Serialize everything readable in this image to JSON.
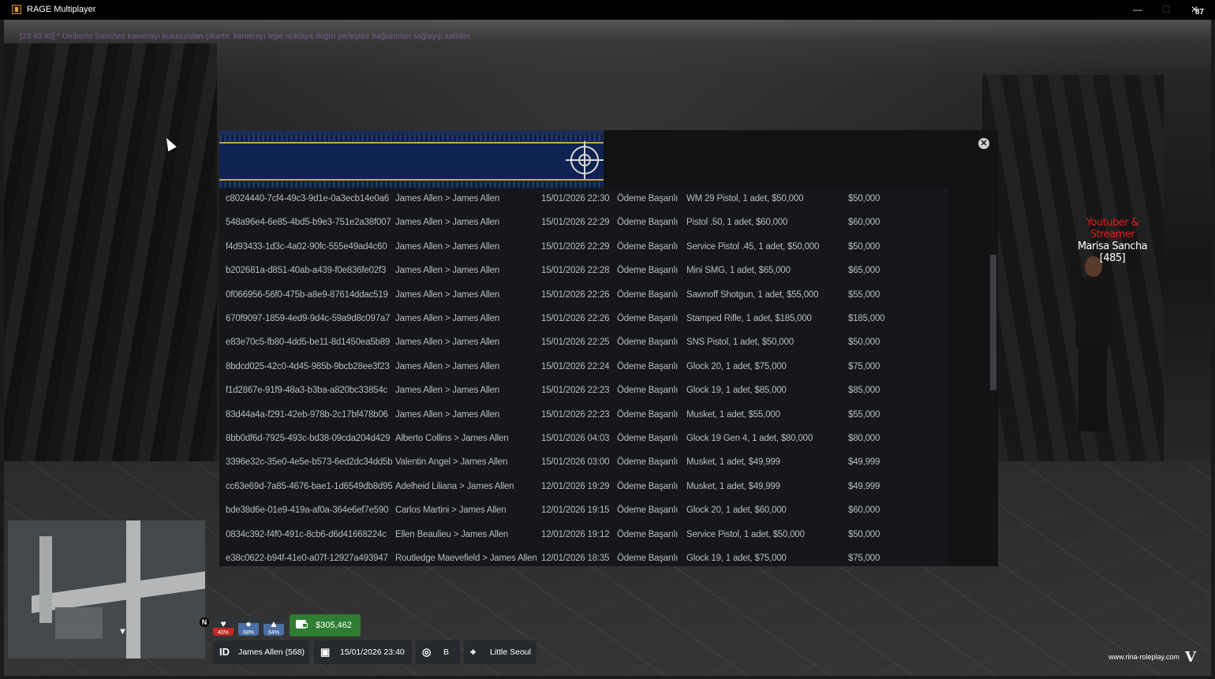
{
  "window": {
    "title": "RAGE Multiplayer",
    "fps": "87",
    "minimize": "—",
    "maximize": "☐",
    "close": "✕"
  },
  "chat": {
    "line": "[23:40:40] * Umberto Sanchez kamerayı kutusundan çıkartır, kamerayı tepe noktaya doğru yerleştirir bağlantıları sağlayıp sabitler."
  },
  "npc": {
    "role": "Youtuber & Streamer",
    "name": "Marisa Sancha [485]"
  },
  "modal": {
    "close_icon": "close-icon",
    "rows": [
      {
        "id": "c8024440-7cf4-49c3-9d1e-0a3ecb14e0a6",
        "from": "James Allen > James Allen",
        "date": "15/01/2026 22:30",
        "status": "Ödeme Başarılı",
        "item": "WM 29 Pistol, 1 adet, $50,000",
        "amount": "$50,000"
      },
      {
        "id": "548a96e4-6e85-4bd5-b9e3-751e2a38f007",
        "from": "James Allen > James Allen",
        "date": "15/01/2026 22:29",
        "status": "Ödeme Başarılı",
        "item": "Pistol .50, 1 adet, $60,000",
        "amount": "$60,000"
      },
      {
        "id": "f4d93433-1d3c-4a02-90fc-555e49ad4c60",
        "from": "James Allen > James Allen",
        "date": "15/01/2026 22:29",
        "status": "Ödeme Başarılı",
        "item": "Service Pistol .45, 1 adet, $50,000",
        "amount": "$50,000"
      },
      {
        "id": "b202681a-d851-40ab-a439-f0e836fe02f3",
        "from": "James Allen > James Allen",
        "date": "15/01/2026 22:28",
        "status": "Ödeme Başarılı",
        "item": "Mini SMG, 1 adet, $65,000",
        "amount": "$65,000"
      },
      {
        "id": "0f066956-56f0-475b-a8e9-87614ddac519",
        "from": "James Allen > James Allen",
        "date": "15/01/2026 22:26",
        "status": "Ödeme Başarılı",
        "item": "Sawnoff Shotgun, 1 adet, $55,000",
        "amount": "$55,000"
      },
      {
        "id": "670f9097-1859-4ed9-9d4c-59a9d8c097a7",
        "from": "James Allen > James Allen",
        "date": "15/01/2026 22:26",
        "status": "Ödeme Başarılı",
        "item": "Stamped Rifle, 1 adet, $185,000",
        "amount": "$185,000"
      },
      {
        "id": "e83e70c5-fb80-4dd5-be11-8d1450ea5b89",
        "from": "James Allen > James Allen",
        "date": "15/01/2026 22:25",
        "status": "Ödeme Başarılı",
        "item": "SNS Pistol, 1 adet, $50,000",
        "amount": "$50,000"
      },
      {
        "id": "8bdcd025-42c0-4d45-985b-9bcb28ee3f23",
        "from": "James Allen > James Allen",
        "date": "15/01/2026 22:24",
        "status": "Ödeme Başarılı",
        "item": "Glock 20, 1 adet, $75,000",
        "amount": "$75,000"
      },
      {
        "id": "f1d2867e-91f9-48a3-b3ba-a820bc33854c",
        "from": "James Allen > James Allen",
        "date": "15/01/2026 22:23",
        "status": "Ödeme Başarılı",
        "item": "Glock 19, 1 adet, $85,000",
        "amount": "$85,000"
      },
      {
        "id": "83d44a4a-f291-42eb-978b-2c17bf478b06",
        "from": "James Allen > James Allen",
        "date": "15/01/2026 22:23",
        "status": "Ödeme Başarılı",
        "item": "Musket, 1 adet, $55,000",
        "amount": "$55,000"
      },
      {
        "id": "8bb0df6d-7925-493c-bd38-09cda204d429",
        "from": "Alberto Collins > James Allen",
        "date": "15/01/2026 04:03",
        "status": "Ödeme Başarılı",
        "item": "Glock 19 Gen 4, 1 adet, $80,000",
        "amount": "$80,000"
      },
      {
        "id": "3396e32c-35e0-4e5e-b573-6ed2dc34dd5b",
        "from": "Valentin Angel > James Allen",
        "date": "15/01/2026 03:00",
        "status": "Ödeme Başarılı",
        "item": "Musket, 1 adet, $49,999",
        "amount": "$49,999"
      },
      {
        "id": "cc63e69d-7a85-4676-bae1-1d6549db8d95",
        "from": "Adelheid Liliana > James Allen",
        "date": "12/01/2026 19:29",
        "status": "Ödeme Başarılı",
        "item": "Musket, 1 adet, $49,999",
        "amount": "$49,999"
      },
      {
        "id": "bde38d6e-01e9-419a-af0a-364e6ef7e590",
        "from": "Carlos Martini > James Allen",
        "date": "12/01/2026 19:15",
        "status": "Ödeme Başarılı",
        "item": "Glock 20, 1 adet, $60,000",
        "amount": "$60,000"
      },
      {
        "id": "0834c392-f4f0-491c-8cb6-d6d41668224c",
        "from": "Ellen Beaulieu > James Allen",
        "date": "12/01/2026 19:12",
        "status": "Ödeme Başarılı",
        "item": "Service Pistol, 1 adet, $50,000",
        "amount": "$50,000"
      },
      {
        "id": "e38c0622-b94f-41e0-a07f-12927a493947",
        "from": "Routledge Maevefield > James Allen",
        "date": "12/01/2026 18:35",
        "status": "Ödeme Başarılı",
        "item": "Glock 19, 1 adet, $75,000",
        "amount": "$75,000"
      }
    ]
  },
  "hud": {
    "north": "N",
    "stats": [
      {
        "icon": "heart-icon",
        "glyph": "♥",
        "pct": "40%",
        "level": 0.4,
        "color": "#c62828"
      },
      {
        "icon": "food-icon",
        "glyph": "●",
        "pct": "68%",
        "level": 0.68,
        "color": "#4a6fa5"
      },
      {
        "icon": "drink-icon",
        "glyph": "▲",
        "pct": "64%",
        "level": 0.64,
        "color": "#4a6fa5"
      }
    ],
    "money": "$305,462",
    "id_label": "ID",
    "player": "James Allen (568)",
    "datetime": "15/01/2026 23:40",
    "heading": "B",
    "location": "Little Seoul"
  },
  "watermark": {
    "site": "www.rina-roleplay.com",
    "logo": "V"
  }
}
